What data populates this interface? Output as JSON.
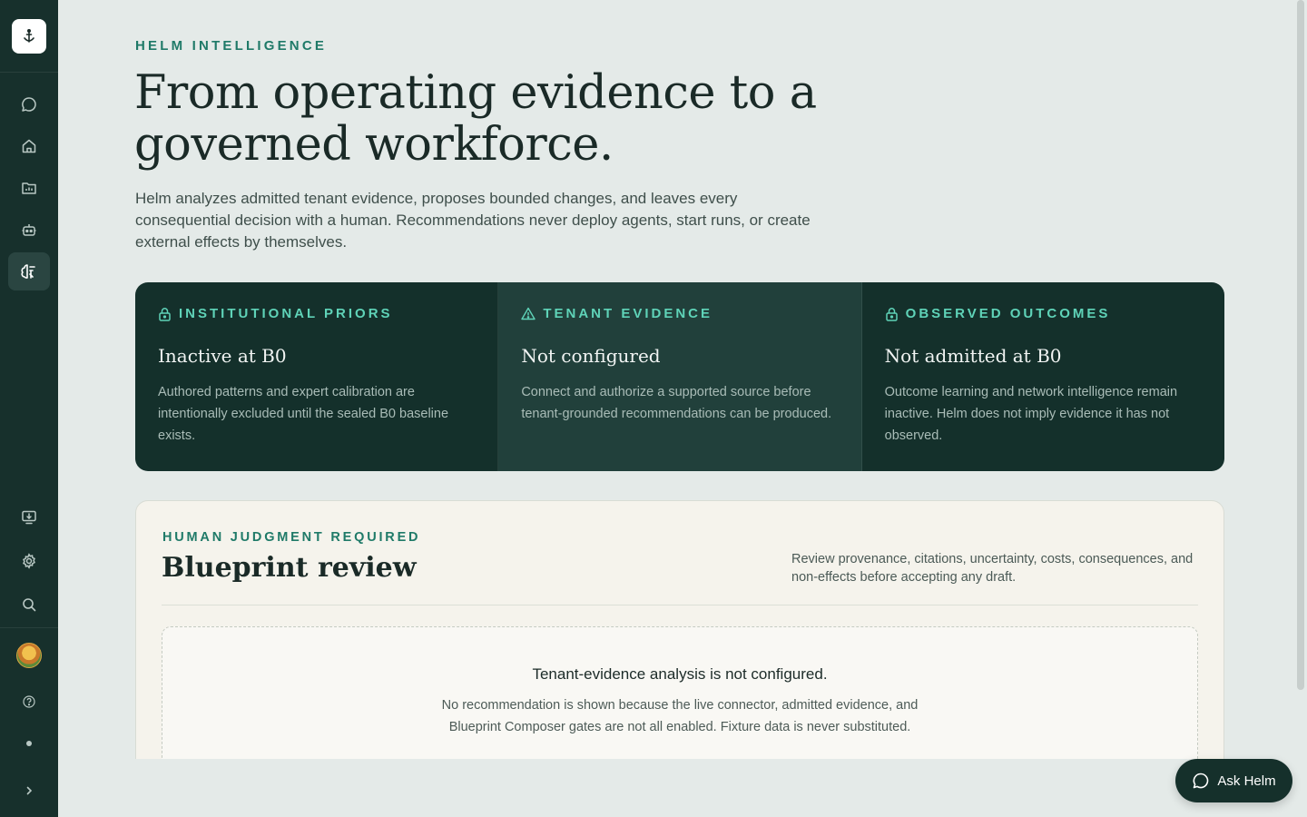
{
  "sidebar": {
    "logo_icon": "anchor-icon",
    "nav_top": [
      {
        "id": "chat",
        "icon": "chat-icon"
      },
      {
        "id": "home",
        "icon": "home-icon"
      },
      {
        "id": "reports",
        "icon": "folder-chart-icon"
      },
      {
        "id": "agents",
        "icon": "robot-icon"
      },
      {
        "id": "intelligence",
        "icon": "brain-icon",
        "active": true
      }
    ],
    "nav_bottom": [
      {
        "id": "install",
        "icon": "monitor-download-icon"
      },
      {
        "id": "settings",
        "icon": "gear-icon"
      },
      {
        "id": "search",
        "icon": "search-icon"
      }
    ]
  },
  "hero": {
    "eyebrow": "HELM INTELLIGENCE",
    "headline": "From operating evidence to a governed workforce.",
    "lede": "Helm analyzes admitted tenant evidence, proposes bounded changes, and leaves every consequential decision with a human. Recommendations never deploy agents, start runs, or create external effects by themselves."
  },
  "cards": [
    {
      "icon": "lock-icon",
      "label": "INSTITUTIONAL PRIORS",
      "title": "Inactive at B0",
      "body": "Authored patterns and expert calibration are intentionally excluded until the sealed B0 baseline exists."
    },
    {
      "icon": "warning-icon",
      "label": "TENANT EVIDENCE",
      "title": "Not configured",
      "body": "Connect and authorize a supported source before tenant-grounded recommendations can be produced."
    },
    {
      "icon": "lock-icon",
      "label": "OBSERVED OUTCOMES",
      "title": "Not admitted at B0",
      "body": "Outcome learning and network intelligence remain inactive. Helm does not imply evidence it has not observed."
    }
  ],
  "review": {
    "eyebrow": "HUMAN JUDGMENT REQUIRED",
    "title": "Blueprint review",
    "note": "Review provenance, citations, uncertainty, costs, consequences, and non-effects before accepting any draft.",
    "empty_title": "Tenant-evidence analysis is not configured.",
    "empty_body": "No recommendation is shown because the live connector, admitted evidence, and Blueprint Composer gates are not all enabled. Fixture data is never substituted."
  },
  "ask_button": {
    "label": "Ask Helm",
    "icon": "chat-icon"
  },
  "colors": {
    "sidebar": "#17302c",
    "accent": "#1f7a68",
    "card_label": "#5fd3b8",
    "card_bg": "#14302b"
  }
}
